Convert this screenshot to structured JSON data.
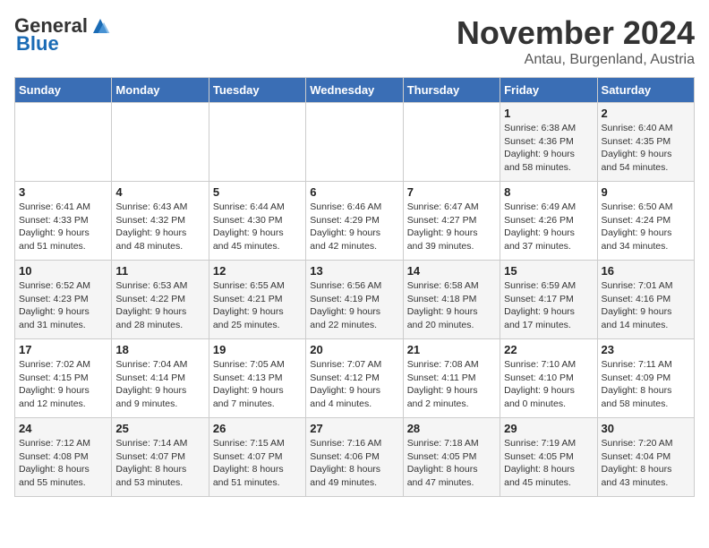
{
  "header": {
    "logo_general": "General",
    "logo_blue": "Blue",
    "month": "November 2024",
    "location": "Antau, Burgenland, Austria"
  },
  "weekdays": [
    "Sunday",
    "Monday",
    "Tuesday",
    "Wednesday",
    "Thursday",
    "Friday",
    "Saturday"
  ],
  "weeks": [
    [
      {
        "day": "",
        "info": ""
      },
      {
        "day": "",
        "info": ""
      },
      {
        "day": "",
        "info": ""
      },
      {
        "day": "",
        "info": ""
      },
      {
        "day": "",
        "info": ""
      },
      {
        "day": "1",
        "info": "Sunrise: 6:38 AM\nSunset: 4:36 PM\nDaylight: 9 hours\nand 58 minutes."
      },
      {
        "day": "2",
        "info": "Sunrise: 6:40 AM\nSunset: 4:35 PM\nDaylight: 9 hours\nand 54 minutes."
      }
    ],
    [
      {
        "day": "3",
        "info": "Sunrise: 6:41 AM\nSunset: 4:33 PM\nDaylight: 9 hours\nand 51 minutes."
      },
      {
        "day": "4",
        "info": "Sunrise: 6:43 AM\nSunset: 4:32 PM\nDaylight: 9 hours\nand 48 minutes."
      },
      {
        "day": "5",
        "info": "Sunrise: 6:44 AM\nSunset: 4:30 PM\nDaylight: 9 hours\nand 45 minutes."
      },
      {
        "day": "6",
        "info": "Sunrise: 6:46 AM\nSunset: 4:29 PM\nDaylight: 9 hours\nand 42 minutes."
      },
      {
        "day": "7",
        "info": "Sunrise: 6:47 AM\nSunset: 4:27 PM\nDaylight: 9 hours\nand 39 minutes."
      },
      {
        "day": "8",
        "info": "Sunrise: 6:49 AM\nSunset: 4:26 PM\nDaylight: 9 hours\nand 37 minutes."
      },
      {
        "day": "9",
        "info": "Sunrise: 6:50 AM\nSunset: 4:24 PM\nDaylight: 9 hours\nand 34 minutes."
      }
    ],
    [
      {
        "day": "10",
        "info": "Sunrise: 6:52 AM\nSunset: 4:23 PM\nDaylight: 9 hours\nand 31 minutes."
      },
      {
        "day": "11",
        "info": "Sunrise: 6:53 AM\nSunset: 4:22 PM\nDaylight: 9 hours\nand 28 minutes."
      },
      {
        "day": "12",
        "info": "Sunrise: 6:55 AM\nSunset: 4:21 PM\nDaylight: 9 hours\nand 25 minutes."
      },
      {
        "day": "13",
        "info": "Sunrise: 6:56 AM\nSunset: 4:19 PM\nDaylight: 9 hours\nand 22 minutes."
      },
      {
        "day": "14",
        "info": "Sunrise: 6:58 AM\nSunset: 4:18 PM\nDaylight: 9 hours\nand 20 minutes."
      },
      {
        "day": "15",
        "info": "Sunrise: 6:59 AM\nSunset: 4:17 PM\nDaylight: 9 hours\nand 17 minutes."
      },
      {
        "day": "16",
        "info": "Sunrise: 7:01 AM\nSunset: 4:16 PM\nDaylight: 9 hours\nand 14 minutes."
      }
    ],
    [
      {
        "day": "17",
        "info": "Sunrise: 7:02 AM\nSunset: 4:15 PM\nDaylight: 9 hours\nand 12 minutes."
      },
      {
        "day": "18",
        "info": "Sunrise: 7:04 AM\nSunset: 4:14 PM\nDaylight: 9 hours\nand 9 minutes."
      },
      {
        "day": "19",
        "info": "Sunrise: 7:05 AM\nSunset: 4:13 PM\nDaylight: 9 hours\nand 7 minutes."
      },
      {
        "day": "20",
        "info": "Sunrise: 7:07 AM\nSunset: 4:12 PM\nDaylight: 9 hours\nand 4 minutes."
      },
      {
        "day": "21",
        "info": "Sunrise: 7:08 AM\nSunset: 4:11 PM\nDaylight: 9 hours\nand 2 minutes."
      },
      {
        "day": "22",
        "info": "Sunrise: 7:10 AM\nSunset: 4:10 PM\nDaylight: 9 hours\nand 0 minutes."
      },
      {
        "day": "23",
        "info": "Sunrise: 7:11 AM\nSunset: 4:09 PM\nDaylight: 8 hours\nand 58 minutes."
      }
    ],
    [
      {
        "day": "24",
        "info": "Sunrise: 7:12 AM\nSunset: 4:08 PM\nDaylight: 8 hours\nand 55 minutes."
      },
      {
        "day": "25",
        "info": "Sunrise: 7:14 AM\nSunset: 4:07 PM\nDaylight: 8 hours\nand 53 minutes."
      },
      {
        "day": "26",
        "info": "Sunrise: 7:15 AM\nSunset: 4:07 PM\nDaylight: 8 hours\nand 51 minutes."
      },
      {
        "day": "27",
        "info": "Sunrise: 7:16 AM\nSunset: 4:06 PM\nDaylight: 8 hours\nand 49 minutes."
      },
      {
        "day": "28",
        "info": "Sunrise: 7:18 AM\nSunset: 4:05 PM\nDaylight: 8 hours\nand 47 minutes."
      },
      {
        "day": "29",
        "info": "Sunrise: 7:19 AM\nSunset: 4:05 PM\nDaylight: 8 hours\nand 45 minutes."
      },
      {
        "day": "30",
        "info": "Sunrise: 7:20 AM\nSunset: 4:04 PM\nDaylight: 8 hours\nand 43 minutes."
      }
    ]
  ]
}
